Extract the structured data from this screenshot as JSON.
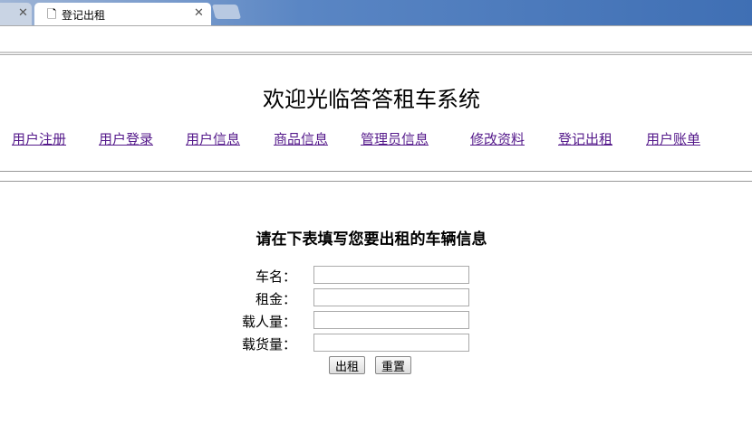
{
  "browser": {
    "tab_title": "登记出租"
  },
  "page": {
    "title": "欢迎光临答答租车系统",
    "nav": [
      "用户注册",
      "用户登录",
      "用户信息",
      "商品信息",
      "管理员信息",
      "修改资料",
      "登记出租",
      "用户账单"
    ],
    "form_heading": "请在下表填写您要出租的车辆信息",
    "fields": [
      {
        "label": "车名：",
        "value": ""
      },
      {
        "label": "租金：",
        "value": ""
      },
      {
        "label": "载人量：",
        "value": ""
      },
      {
        "label": "载货量：",
        "value": ""
      }
    ],
    "submit_label": "出租",
    "reset_label": "重置"
  }
}
